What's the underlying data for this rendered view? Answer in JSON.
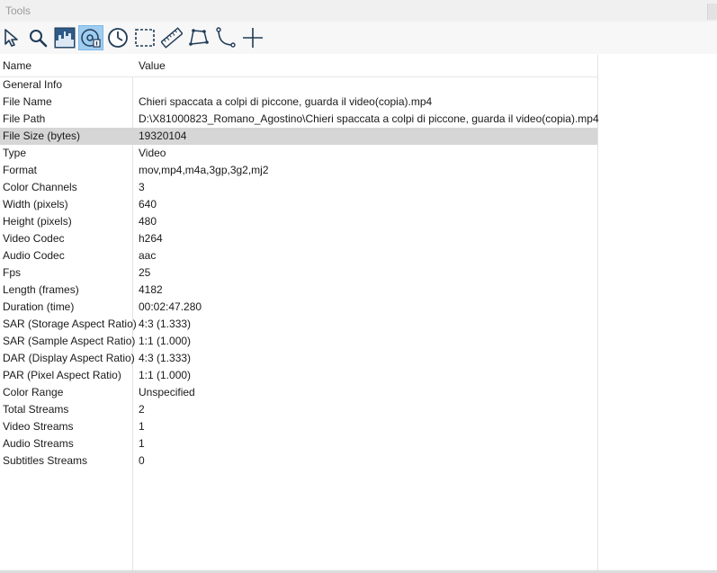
{
  "window": {
    "title": "Tools"
  },
  "toolbar": {
    "tools": [
      {
        "icon": "arrow-pointer-icon",
        "active": false
      },
      {
        "icon": "magnifier-icon",
        "active": false
      },
      {
        "icon": "histogram-icon",
        "active": false
      },
      {
        "icon": "media-info-icon",
        "active": true
      },
      {
        "icon": "clock-icon",
        "active": false
      },
      {
        "icon": "rectangle-select-icon",
        "active": false
      },
      {
        "icon": "ruler-icon",
        "active": false
      },
      {
        "icon": "polygon-icon",
        "active": false
      },
      {
        "icon": "curve-icon",
        "active": false
      },
      {
        "icon": "crosshair-icon",
        "active": false
      }
    ],
    "active_color": "#9fcdf0"
  },
  "table": {
    "headers": {
      "name": "Name",
      "value": "Value"
    },
    "selected_row": 3,
    "selected_color": "#d6d6d6",
    "rows": [
      {
        "name": "General Info",
        "value": ""
      },
      {
        "name": "File Name",
        "value": "Chieri spaccata a colpi di piccone, guarda il video(copia).mp4"
      },
      {
        "name": "File Path",
        "value": "D:\\X81000823_Romano_Agostino\\Chieri spaccata a colpi di piccone, guarda il video(copia).mp4"
      },
      {
        "name": "File Size (bytes)",
        "value": "19320104"
      },
      {
        "name": "Type",
        "value": "Video"
      },
      {
        "name": "Format",
        "value": "mov,mp4,m4a,3gp,3g2,mj2"
      },
      {
        "name": "Color Channels",
        "value": "3"
      },
      {
        "name": "Width (pixels)",
        "value": "640"
      },
      {
        "name": "Height (pixels)",
        "value": "480"
      },
      {
        "name": "Video Codec",
        "value": "h264"
      },
      {
        "name": "Audio Codec",
        "value": "aac"
      },
      {
        "name": "Fps",
        "value": "25"
      },
      {
        "name": "Length (frames)",
        "value": "4182"
      },
      {
        "name": "Duration (time)",
        "value": "00:02:47.280"
      },
      {
        "name": "SAR (Storage Aspect Ratio)",
        "value": "4:3 (1.333)"
      },
      {
        "name": "SAR (Sample Aspect Ratio)",
        "value": "1:1 (1.000)"
      },
      {
        "name": "DAR (Display Aspect Ratio)",
        "value": "4:3 (1.333)"
      },
      {
        "name": "PAR (Pixel Aspect Ratio)",
        "value": "1:1 (1.000)"
      },
      {
        "name": "Color Range",
        "value": "Unspecified"
      },
      {
        "name": "Total Streams",
        "value": "2"
      },
      {
        "name": "Video Streams",
        "value": "1"
      },
      {
        "name": "Audio Streams",
        "value": "1"
      },
      {
        "name": "Subtitles Streams",
        "value": "0"
      }
    ]
  }
}
